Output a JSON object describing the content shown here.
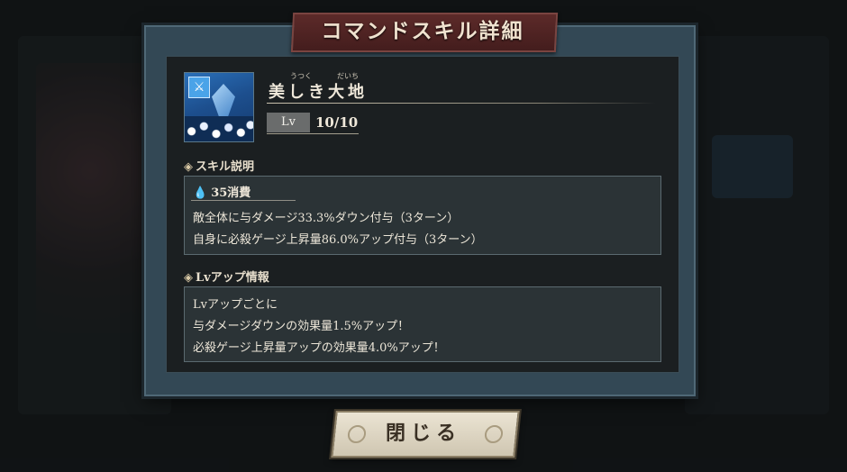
{
  "dialog": {
    "title": "コマンドスキル詳細",
    "close_label": "閉じる"
  },
  "skill": {
    "name": "美しき大地",
    "furigana_1": "うつく",
    "furigana_2": "だいち",
    "level_label": "Lv",
    "level_value": "10/10",
    "icon": "blue-crystal-sword-skill-icon"
  },
  "description": {
    "heading": "スキル説明",
    "cost": "35消費",
    "cost_icon": "water-drop-icon",
    "lines": [
      "敵全体に与ダメージ33.3%ダウン付与（3ターン）",
      "自身に必殺ゲージ上昇量86.0%アップ付与（3ターン）"
    ]
  },
  "levelup": {
    "heading": "Lvアップ情報",
    "lines": [
      "Lvアップごとに",
      "与ダメージダウンの効果量1.5%アップ！",
      "必殺ゲージ上昇量アップの効果量4.0%アップ！"
    ]
  },
  "colors": {
    "banner": "#5c2a29",
    "frame": "#334855",
    "panel": "#1b1f21",
    "box": "#2b3336",
    "button": "#ebe4d3"
  }
}
